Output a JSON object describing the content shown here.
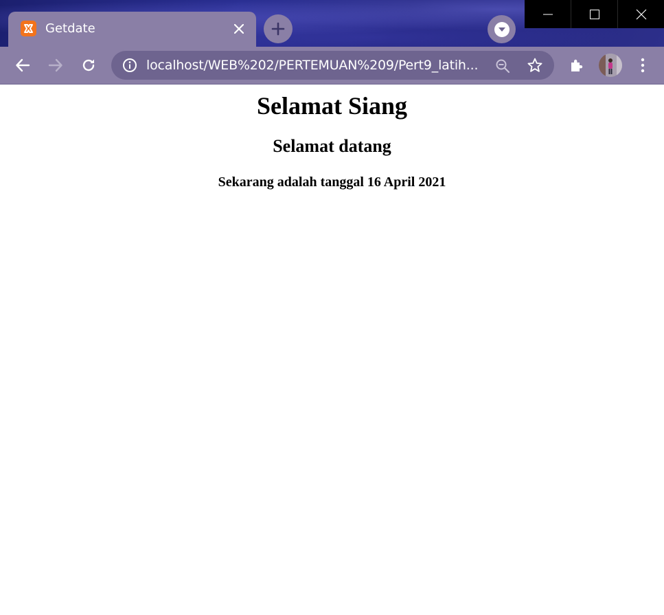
{
  "browser": {
    "tab": {
      "title": "Getdate",
      "favicon": "xampp-icon",
      "favicon_color": "#f2731c"
    },
    "toolbar": {
      "url": "localhost/WEB%202/PERTEMUAN%209/Pert9_latih..."
    },
    "colors": {
      "frame": "#8a7fa6",
      "omnibox": "#6e648f",
      "window_controls": "#000000"
    }
  },
  "page": {
    "heading1": "Selamat Siang",
    "heading2": "Selamat datang",
    "heading3": "Sekarang adalah tanggal 16 April 2021"
  }
}
